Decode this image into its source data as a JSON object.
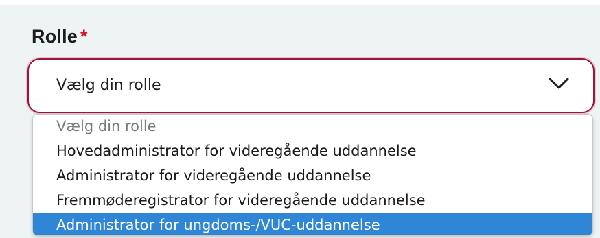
{
  "field": {
    "label": "Rolle",
    "required_mark": "*"
  },
  "select": {
    "current_value": "Vælg din rolle",
    "icon": "chevron-down-icon",
    "border_color": "#a3123a"
  },
  "dropdown": {
    "options": [
      {
        "label": "Vælg din rolle",
        "placeholder": true
      },
      {
        "label": "Hovedadministrator for videregående uddannelse"
      },
      {
        "label": "Administrator for videregående uddannelse"
      },
      {
        "label": "Fremmøderegistrator for videregående uddannelse"
      },
      {
        "label": "Administrator for ungdoms-/VUC-uddannelse",
        "highlighted": true
      }
    ],
    "highlight_color": "#2f86d6"
  },
  "colors": {
    "panel_background": "#eef3f4",
    "required": "#d11a2a"
  }
}
